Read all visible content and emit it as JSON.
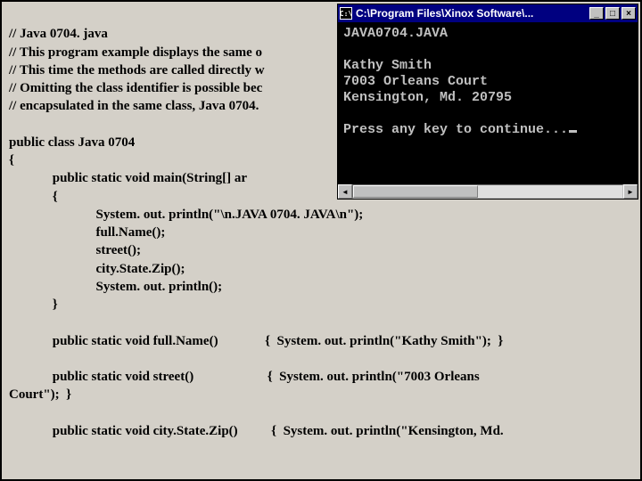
{
  "code": {
    "c1": "// Java 0704. java",
    "c2": "// This program example displays the same o",
    "c3": "// This time the methods are called directly w",
    "c4": "// Omitting the class identifier is possible bec",
    "c5": "// encapsulated in the same class, Java 0704.",
    "blank1": "",
    "l1": "public class Java 0704",
    "l2": "{",
    "l3": "             public static void main(String[] ar",
    "l4": "             {",
    "l5": "                          System. out. println(\"\\n.JAVA 0704. JAVA\\n\");",
    "l6": "                          full.Name();",
    "l7": "                          street();",
    "l8": "                          city.State.Zip();",
    "l9": "                          System. out. println();",
    "l10": "             }",
    "blank2": "",
    "l11": "             public static void full.Name()              {  System. out. println(\"Kathy Smith\");  }",
    "blank3": "",
    "l12": "             public static void street()                      {  System. out. println(\"7003 Orleans",
    "l13": "Court\");  }",
    "blank4": "",
    "l14": "             public static void city.State.Zip()          {  System. out. println(\"Kensington, Md."
  },
  "console": {
    "icon_text": "C:\\",
    "title": "C:\\Program Files\\Xinox Software\\...",
    "min_label": "_",
    "max_label": "□",
    "close_label": "×",
    "line1": "JAVA0704.JAVA",
    "line2": "",
    "line3": "Kathy Smith",
    "line4": "7003 Orleans Court",
    "line5": "Kensington, Md. 20795",
    "line6": "",
    "line7": "Press any key to continue...",
    "left_arrow": "◄",
    "right_arrow": "►"
  }
}
